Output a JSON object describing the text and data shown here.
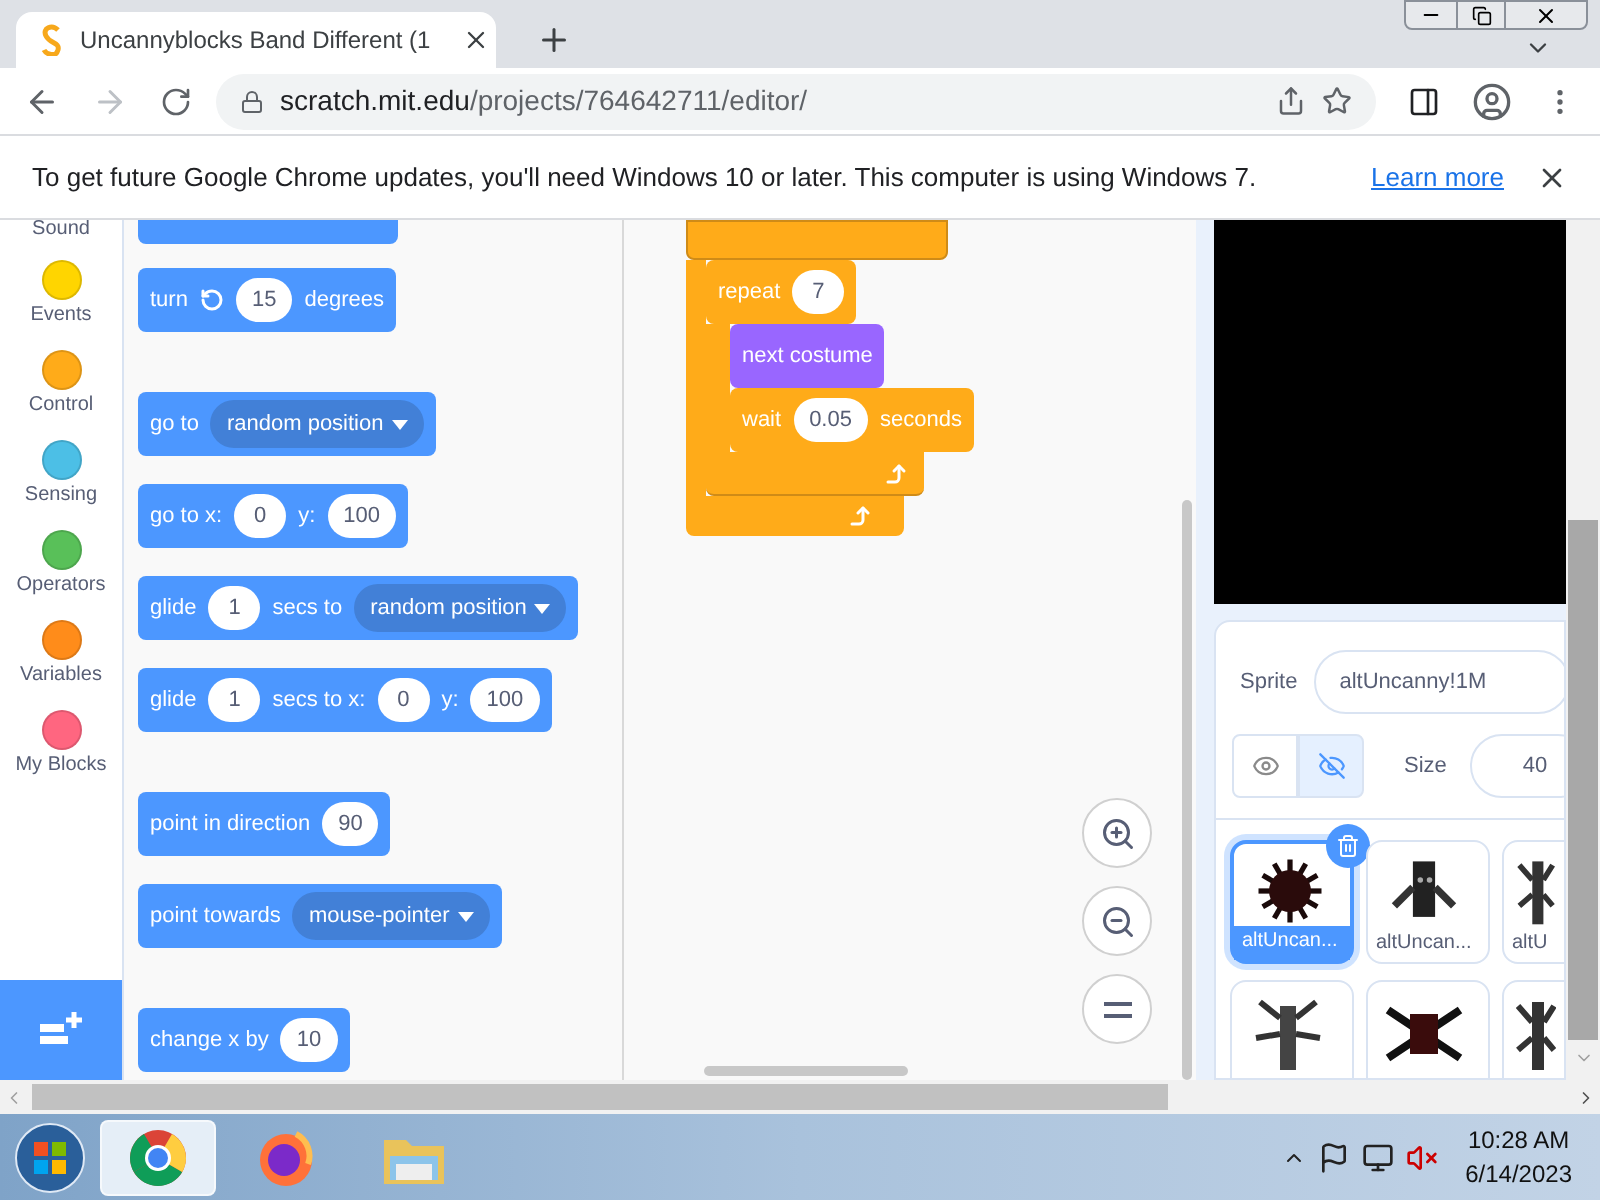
{
  "browser": {
    "tab": {
      "title": "Uncannyblocks Band Different (1"
    },
    "address": {
      "host": "scratch.mit.edu",
      "path": "/projects/764642711/editor/"
    }
  },
  "infobar": {
    "message": "To get future Google Chrome updates, you'll need Windows 10 or later. This computer is using Windows 7.",
    "link": "Learn more"
  },
  "categories": {
    "partial_label": "Sound",
    "items": [
      {
        "label": "Events",
        "color": "#ffd500"
      },
      {
        "label": "Control",
        "color": "#ffab19"
      },
      {
        "label": "Sensing",
        "color": "#4cbfe6"
      },
      {
        "label": "Operators",
        "color": "#59c059"
      },
      {
        "label": "Variables",
        "color": "#ff8c1a"
      },
      {
        "label": "My Blocks",
        "color": "#ff6680"
      }
    ]
  },
  "palette": {
    "groups": [
      [
        {
          "parts": [
            {
              "kind": "text",
              "text": "turn"
            },
            {
              "kind": "icon"
            },
            {
              "kind": "number",
              "text": "15"
            },
            {
              "kind": "text",
              "text": "degrees"
            }
          ]
        }
      ],
      [
        {
          "parts": [
            {
              "kind": "text",
              "text": "go to"
            },
            {
              "kind": "dropdown",
              "text": "random position"
            }
          ]
        },
        {
          "parts": [
            {
              "kind": "text",
              "text": "go to x:"
            },
            {
              "kind": "number",
              "text": "0"
            },
            {
              "kind": "text",
              "text": "y:"
            },
            {
              "kind": "number",
              "text": "100"
            }
          ]
        },
        {
          "parts": [
            {
              "kind": "text",
              "text": "glide"
            },
            {
              "kind": "number",
              "text": "1"
            },
            {
              "kind": "text",
              "text": "secs to"
            },
            {
              "kind": "dropdown",
              "text": "random position"
            }
          ]
        },
        {
          "parts": [
            {
              "kind": "text",
              "text": "glide"
            },
            {
              "kind": "number",
              "text": "1"
            },
            {
              "kind": "text",
              "text": "secs to x:"
            },
            {
              "kind": "number",
              "text": "0"
            },
            {
              "kind": "text",
              "text": "y:"
            },
            {
              "kind": "number",
              "text": "100"
            }
          ]
        }
      ],
      [
        {
          "parts": [
            {
              "kind": "text",
              "text": "point in direction"
            },
            {
              "kind": "number",
              "text": "90"
            }
          ]
        },
        {
          "parts": [
            {
              "kind": "text",
              "text": "point towards"
            },
            {
              "kind": "dropdown",
              "text": "mouse-pointer"
            }
          ]
        }
      ],
      [
        {
          "parts": [
            {
              "kind": "text",
              "text": "change x by"
            },
            {
              "kind": "number",
              "text": "10"
            }
          ]
        }
      ]
    ]
  },
  "script": {
    "repeat": {
      "parts": [
        {
          "kind": "text",
          "text": "repeat"
        },
        {
          "kind": "number",
          "text": "7"
        }
      ],
      "body": [
        {
          "kind": "looks",
          "parts": [
            {
              "kind": "text",
              "text": "next costume"
            }
          ]
        },
        {
          "kind": "control",
          "parts": [
            {
              "kind": "text",
              "text": "wait"
            },
            {
              "kind": "number",
              "text": "0.05"
            },
            {
              "kind": "text",
              "text": "seconds"
            }
          ]
        }
      ]
    }
  },
  "sprite_info": {
    "label": "Sprite",
    "name": "altUncanny!1M",
    "visibility": [
      {
        "kind": "show",
        "selected": false
      },
      {
        "kind": "hide",
        "selected": true
      }
    ],
    "size_label": "Size",
    "size": "40"
  },
  "sprites": [
    {
      "name": "altUncan...",
      "selected": true,
      "kind": "spiky"
    },
    {
      "name": "altUncan...",
      "selected": false,
      "kind": "robot"
    },
    {
      "name": "altU",
      "selected": false,
      "kind": "tentacle"
    },
    {
      "selected": false,
      "kind": "multiarm"
    },
    {
      "selected": false,
      "kind": "spider"
    },
    {
      "selected": false,
      "kind": "tentacle"
    }
  ],
  "taskbar": {
    "apps": [
      {
        "kind": "chrome",
        "selected": true
      },
      {
        "kind": "firefox",
        "selected": false
      },
      {
        "kind": "explorer",
        "selected": false
      }
    ],
    "clock": {
      "time": "10:28 AM",
      "date": "6/14/2023"
    }
  }
}
